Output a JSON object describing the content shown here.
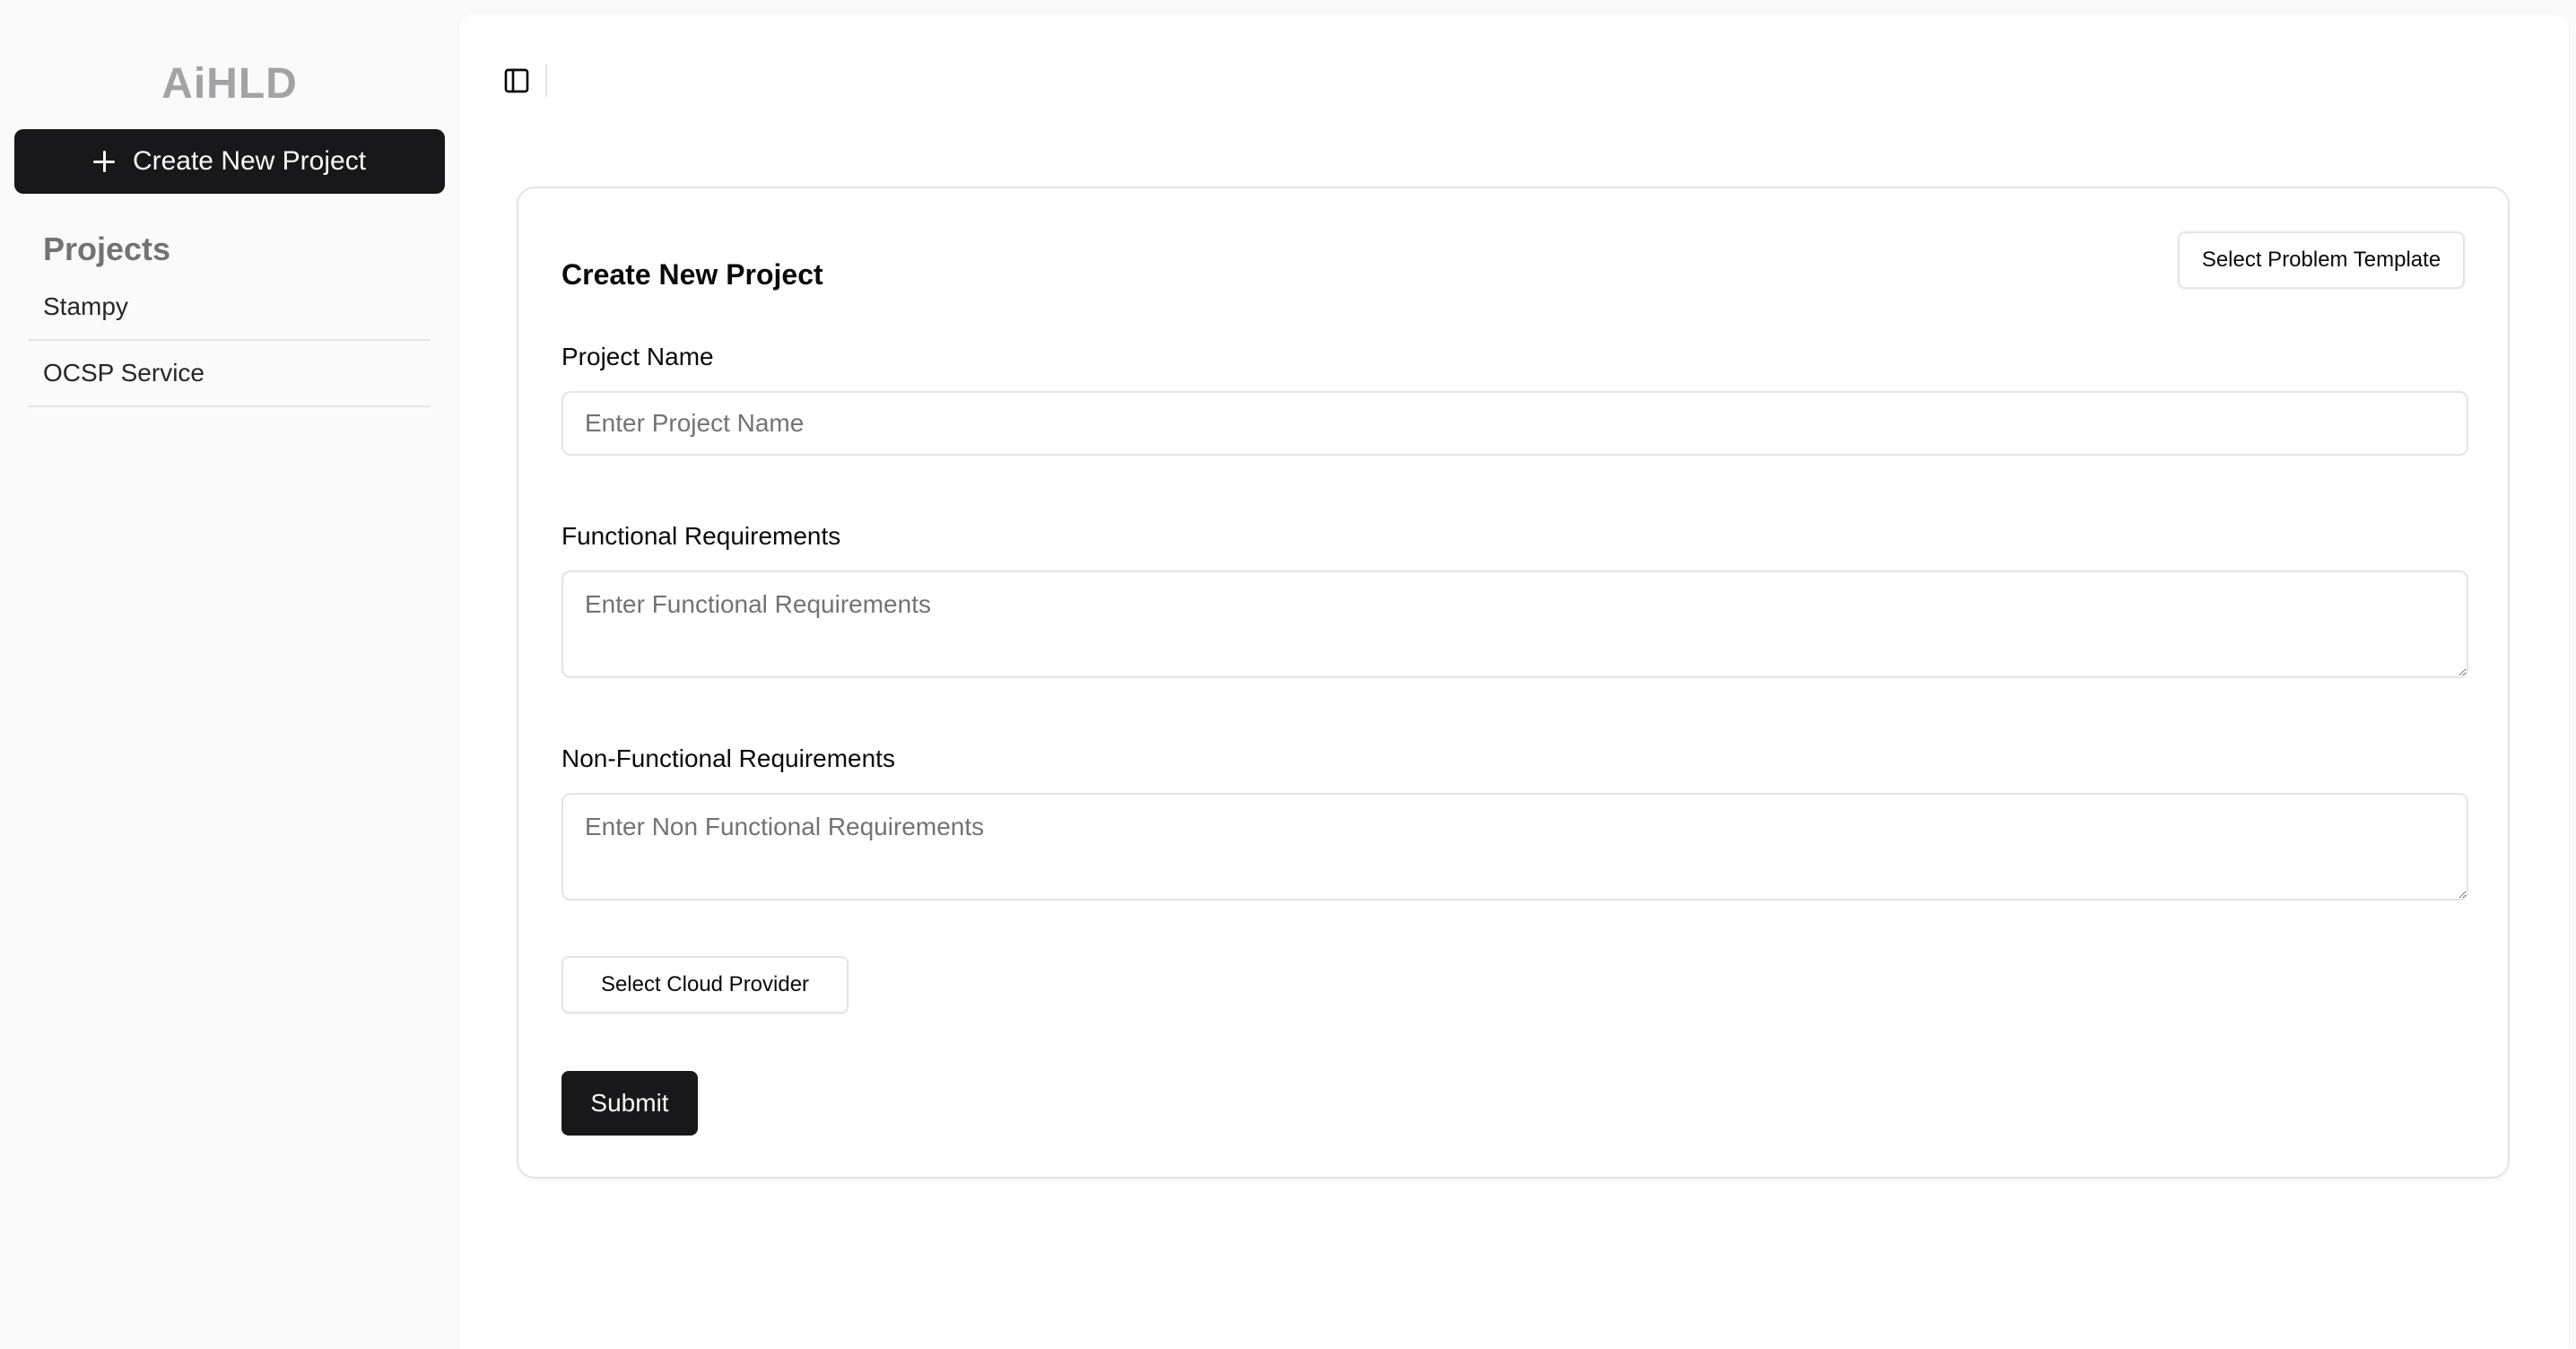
{
  "sidebar": {
    "brand": "AiHLD",
    "new_project_button": "Create New Project",
    "projects_heading": "Projects",
    "projects": [
      {
        "label": "Stampy"
      },
      {
        "label": "OCSP Service"
      }
    ]
  },
  "toolbar": {
    "toggle_icon": "sidebar-panel-icon"
  },
  "form": {
    "title": "Create New Project",
    "template_button": "Select Problem Template",
    "project_name": {
      "label": "Project Name",
      "placeholder": "Enter Project Name",
      "value": ""
    },
    "functional": {
      "label": "Functional Requirements",
      "placeholder": "Enter Functional Requirements",
      "value": ""
    },
    "non_functional": {
      "label": "Non-Functional Requirements",
      "placeholder": "Enter Non Functional Requirements",
      "value": ""
    },
    "cloud_button": "Select Cloud Provider",
    "submit_button": "Submit"
  },
  "colors": {
    "primary": "#18181b",
    "border": "#e4e4e7",
    "muted_text": "#737373",
    "brand_text": "#a3a3a6",
    "sidebar_bg": "#fafafa"
  }
}
